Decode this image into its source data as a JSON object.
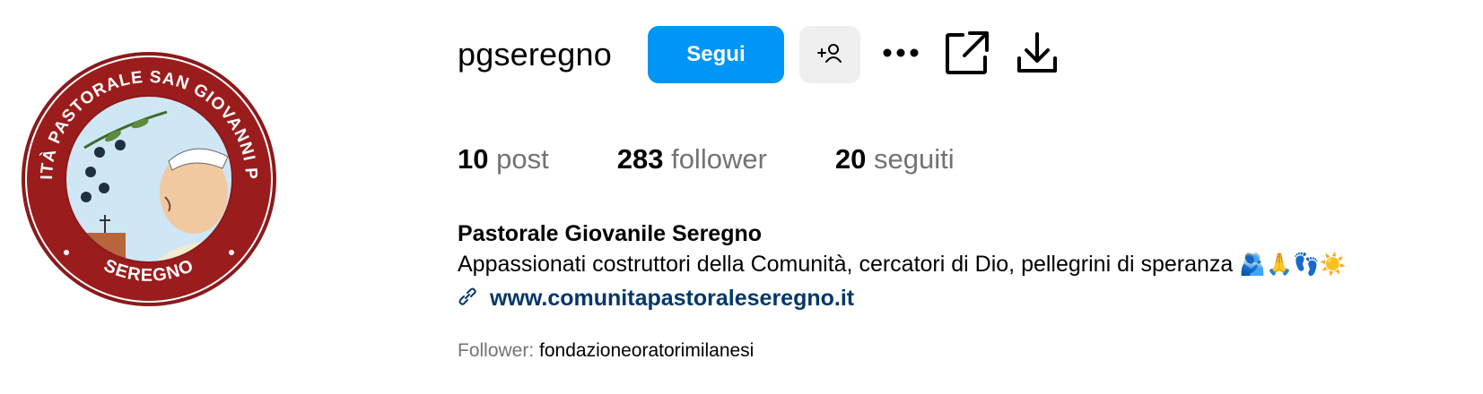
{
  "profile": {
    "username": "pgseregno",
    "follow_label": "Segui",
    "logo_text": {
      "arc_top": "COMUNITÀ PASTORALE SAN GIOVANNI PAOLO II",
      "arc_bottom": "SEREGNO"
    }
  },
  "stats": {
    "posts": {
      "value": "10",
      "label": "post"
    },
    "followers": {
      "value": "283",
      "label": "follower"
    },
    "following": {
      "value": "20",
      "label": "seguiti"
    }
  },
  "bio": {
    "full_name": "Pastorale Giovanile Seregno",
    "description": "Appassionati costruttori della Comunità, cercatori di Dio, pellegrini di speranza",
    "emojis": "🫂🙏👣☀️",
    "link": "www.comunitapastoraleseregno.it"
  },
  "followed_by": {
    "label": "Follower:",
    "names": "fondazioneoratorimilanesi"
  },
  "colors": {
    "accent": "#0095f6",
    "link": "#00376b",
    "muted": "#737373",
    "secondary_button": "#efefef",
    "logo_ring": "#8b1a1a"
  },
  "icons": [
    "add-person-icon",
    "more-options-icon",
    "share-external-icon",
    "download-icon",
    "link-icon"
  ]
}
